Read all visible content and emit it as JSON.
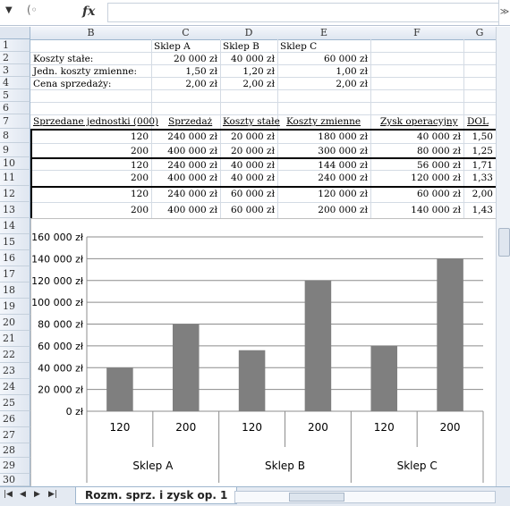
{
  "formula_bar": {
    "fx_label": "fx",
    "value": ""
  },
  "columns": [
    "B",
    "C",
    "D",
    "E",
    "F",
    "G"
  ],
  "rows": [
    "1",
    "2",
    "3",
    "4",
    "5",
    "6",
    "7",
    "8",
    "9",
    "10",
    "11",
    "12",
    "13",
    "14",
    "15",
    "16",
    "17",
    "18",
    "19",
    "20",
    "21",
    "22",
    "23",
    "24",
    "25",
    "26",
    "27",
    "28",
    "29",
    "30"
  ],
  "header_row1": {
    "C": "Sklep A",
    "D": "Sklep B",
    "E": "Sklep C"
  },
  "params": [
    {
      "label": "Koszty stałe:",
      "C": "20 000 zł",
      "D": "40 000 zł",
      "E": "60 000 zł"
    },
    {
      "label": "Jedn. koszty zmienne:",
      "C": "1,50 zł",
      "D": "1,20 zł",
      "E": "1,00 zł"
    },
    {
      "label": "Cena sprzedaży:",
      "C": "2,00 zł",
      "D": "2,00 zł",
      "E": "2,00 zł"
    }
  ],
  "table_headers": [
    "Sprzedane jednostki (000)",
    "Sprzedaż",
    "Koszty stałe",
    "Koszty zmienne",
    "Zysk operacyjny",
    "DOL"
  ],
  "table_rows": [
    [
      "120",
      "240 000 zł",
      "20 000 zł",
      "180 000 zł",
      "40 000 zł",
      "1,50"
    ],
    [
      "200",
      "400 000 zł",
      "20 000 zł",
      "300 000 zł",
      "80 000 zł",
      "1,25"
    ],
    [
      "120",
      "240 000 zł",
      "40 000 zł",
      "144 000 zł",
      "56 000 zł",
      "1,71"
    ],
    [
      "200",
      "400 000 zł",
      "40 000 zł",
      "240 000 zł",
      "120 000 zł",
      "1,33"
    ],
    [
      "120",
      "240 000 zł",
      "60 000 zł",
      "120 000 zł",
      "60 000 zł",
      "2,00"
    ],
    [
      "200",
      "400 000 zł",
      "60 000 zł",
      "200 000 zł",
      "140 000 zł",
      "1,43"
    ]
  ],
  "sheet_tab": "Rozm. sprz. i zysk op. 1",
  "chart_data": {
    "type": "bar",
    "groups": [
      "Sklep A",
      "Sklep B",
      "Sklep C"
    ],
    "categories": [
      "120",
      "200",
      "120",
      "200",
      "120",
      "200"
    ],
    "values": [
      40000,
      80000,
      56000,
      120000,
      60000,
      140000
    ],
    "ylim": [
      0,
      160000
    ],
    "yticks": [
      "0 zł",
      "20 000 zł",
      "40 000 zł",
      "60 000 zł",
      "80 000 zł",
      "100 000 zł",
      "120 000 zł",
      "140 000 zł",
      "160 000 zł"
    ],
    "grid": true,
    "bar_color": "#7f7f7f"
  }
}
